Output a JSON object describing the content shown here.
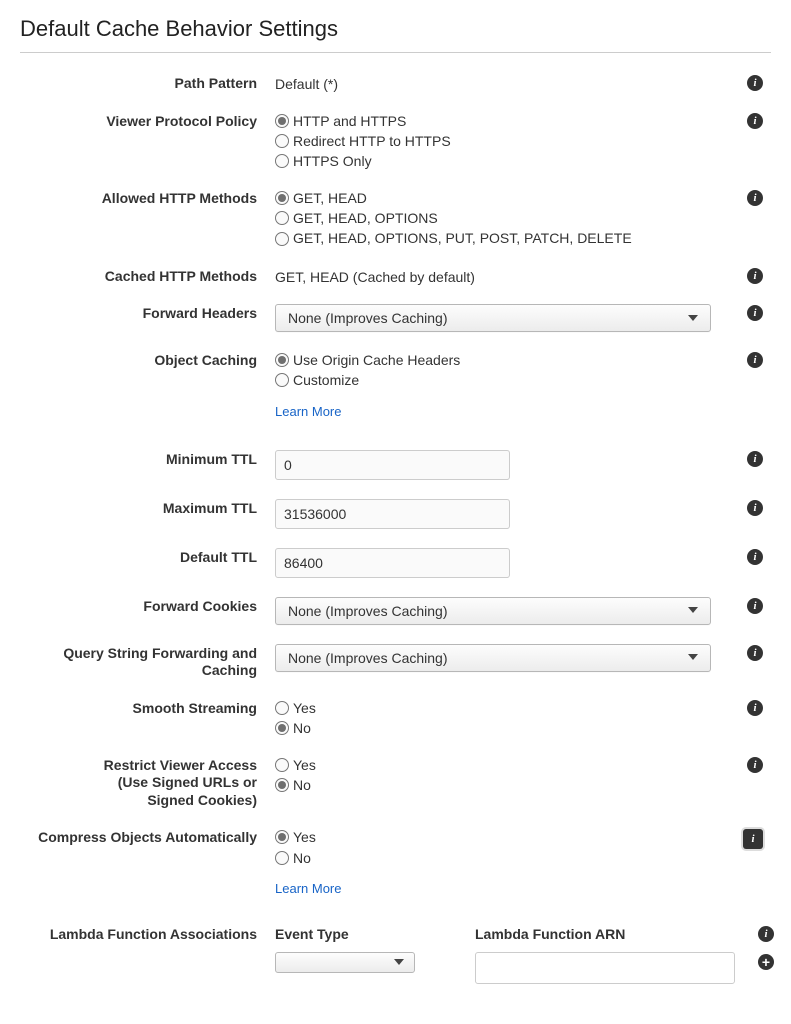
{
  "section_title": "Default Cache Behavior Settings",
  "path_pattern": {
    "label": "Path Pattern",
    "value": "Default (*)"
  },
  "viewer_protocol_policy": {
    "label": "Viewer Protocol Policy",
    "options": {
      "http_https": "HTTP and HTTPS",
      "redirect": "Redirect HTTP to HTTPS",
      "https_only": "HTTPS Only"
    },
    "selected": "http_https"
  },
  "allowed_http_methods": {
    "label": "Allowed HTTP Methods",
    "options": {
      "get_head": "GET, HEAD",
      "get_head_options": "GET, HEAD, OPTIONS",
      "all": "GET, HEAD, OPTIONS, PUT, POST, PATCH, DELETE"
    },
    "selected": "get_head"
  },
  "cached_http_methods": {
    "label": "Cached HTTP Methods",
    "value": "GET, HEAD (Cached by default)"
  },
  "forward_headers": {
    "label": "Forward Headers",
    "selected_text": "None (Improves Caching)"
  },
  "object_caching": {
    "label": "Object Caching",
    "options": {
      "use_origin": "Use Origin Cache Headers",
      "customize": "Customize"
    },
    "selected": "use_origin",
    "learn_more": "Learn More"
  },
  "minimum_ttl": {
    "label": "Minimum TTL",
    "value": "0"
  },
  "maximum_ttl": {
    "label": "Maximum TTL",
    "value": "31536000"
  },
  "default_ttl": {
    "label": "Default TTL",
    "value": "86400"
  },
  "forward_cookies": {
    "label": "Forward Cookies",
    "selected_text": "None (Improves Caching)"
  },
  "query_string": {
    "label": "Query String Forwarding and Caching",
    "selected_text": "None (Improves Caching)"
  },
  "smooth_streaming": {
    "label": "Smooth Streaming",
    "options": {
      "yes": "Yes",
      "no": "No"
    },
    "selected": "no"
  },
  "restrict_viewer_access": {
    "label": "Restrict Viewer Access\n(Use Signed URLs or Signed Cookies)",
    "label_l1": "Restrict Viewer Access",
    "label_l2": "(Use Signed URLs or",
    "label_l3": "Signed Cookies)",
    "options": {
      "yes": "Yes",
      "no": "No"
    },
    "selected": "no"
  },
  "compress_objects": {
    "label": "Compress Objects Automatically",
    "options": {
      "yes": "Yes",
      "no": "No"
    },
    "selected": "yes",
    "learn_more": "Learn More"
  },
  "lambda": {
    "label": "Lambda Function Associations",
    "event_type_header": "Event Type",
    "arn_header": "Lambda Function ARN",
    "event_type_value": "",
    "arn_value": ""
  }
}
